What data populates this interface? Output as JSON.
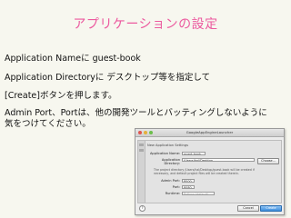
{
  "slide": {
    "title": "アプリケーションの設定",
    "lines": [
      "Application Nameに guest-book",
      "Application Directoryに デスクトップ等を指定して",
      "[Create]ボタンを押します。",
      "Admin Port、Portは、他の開発ツールとバッティングしないように",
      "気をつけてください。"
    ]
  },
  "dialog": {
    "window_title": "GoogleAppEngineLauncher",
    "section_label": "New Application Settings",
    "fields": {
      "application_name_label": "Application Name:",
      "application_name_value": "guest-book",
      "directory_label": "Application Directory:",
      "directory_value": "/Users/hal/Desktop",
      "choose_label": "Choose...",
      "note": "The project directory /Users/hal/Desktop/guest-book will be created if necessary, and default project files will be created therein.",
      "admin_port_label": "Admin Port:",
      "admin_port_value": "8000",
      "port_label": "Port:",
      "port_value": "8080",
      "runtime_label": "Runtime:",
      "runtime_value": "Python (default)"
    },
    "buttons": {
      "cancel": "Cancel",
      "create": "Create",
      "help": "?"
    }
  }
}
